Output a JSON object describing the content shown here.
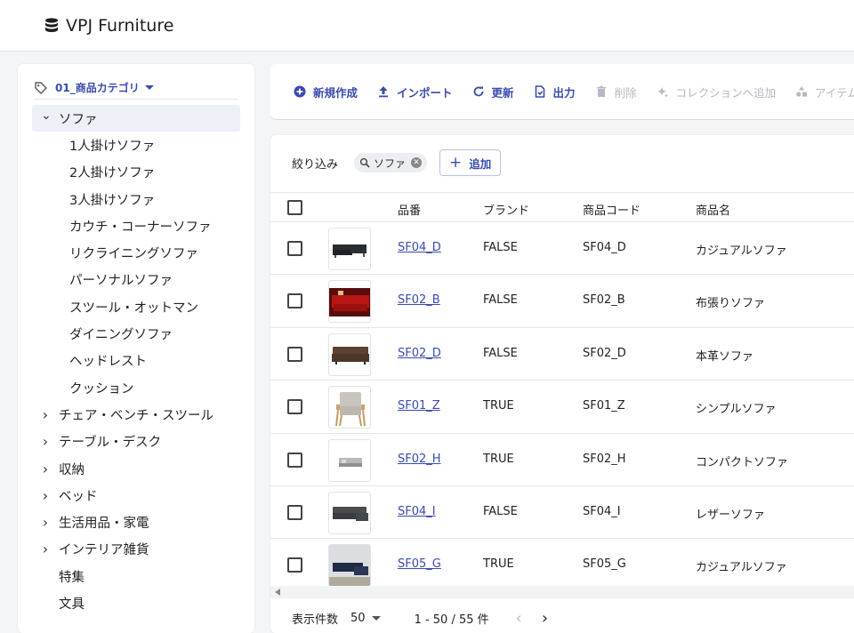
{
  "app": {
    "title": "VPJ Furniture",
    "logo_icon": "database-icon"
  },
  "sidebar": {
    "category_select": "01_商品カテゴリ",
    "tree": [
      {
        "label": "ソファ",
        "expanded": true,
        "selected": true,
        "level": 0
      },
      {
        "label": "1人掛けソファ",
        "level": 1
      },
      {
        "label": "2人掛けソファ",
        "level": 1
      },
      {
        "label": "3人掛けソファ",
        "level": 1
      },
      {
        "label": "カウチ・コーナーソファ",
        "level": 1
      },
      {
        "label": "リクライニングソファ",
        "level": 1
      },
      {
        "label": "パーソナルソファ",
        "level": 1
      },
      {
        "label": "スツール・オットマン",
        "level": 1
      },
      {
        "label": "ダイニングソファ",
        "level": 1
      },
      {
        "label": "ヘッドレスト",
        "level": 1
      },
      {
        "label": "クッション",
        "level": 1
      },
      {
        "label": "チェア・ベンチ・スツール",
        "level": 0,
        "expandable": true
      },
      {
        "label": "テーブル・デスク",
        "level": 0,
        "expandable": true
      },
      {
        "label": "収納",
        "level": 0,
        "expandable": true
      },
      {
        "label": "ベッド",
        "level": 0,
        "expandable": true
      },
      {
        "label": "生活用品・家電",
        "level": 0,
        "expandable": true
      },
      {
        "label": "インテリア雑貨",
        "level": 0,
        "expandable": true
      },
      {
        "label": "特集",
        "level": 0
      },
      {
        "label": "文具",
        "level": 0
      }
    ]
  },
  "toolbar": {
    "new": "新規作成",
    "import": "インポート",
    "refresh": "更新",
    "export": "出力",
    "delete": "削除",
    "add_to_collection": "コレクションへ追加",
    "item_group": "アイテムグ"
  },
  "filter": {
    "label": "絞り込み",
    "chip": "ソファ",
    "add_button": "追加"
  },
  "table": {
    "headers": [
      "品番",
      "ブランド",
      "商品コード",
      "商品名"
    ],
    "rows": [
      {
        "part_no": "SF04_D",
        "brand": "FALSE",
        "code": "SF04_D",
        "name": "カジュアルソファ"
      },
      {
        "part_no": "SF02_B",
        "brand": "FALSE",
        "code": "SF02_B",
        "name": "布張りソファ"
      },
      {
        "part_no": "SF02_D",
        "brand": "FALSE",
        "code": "SF02_D",
        "name": "本革ソファ"
      },
      {
        "part_no": "SF01_Z",
        "brand": "TRUE",
        "code": "SF01_Z",
        "name": "シンプルソファ"
      },
      {
        "part_no": "SF02_H",
        "brand": "TRUE",
        "code": "SF02_H",
        "name": "コンパクトソファ"
      },
      {
        "part_no": "SF04_I",
        "brand": "FALSE",
        "code": "SF04_I",
        "name": "レザーソファ"
      },
      {
        "part_no": "SF05_G",
        "brand": "TRUE",
        "code": "SF05_G",
        "name": "カジュアルソファ"
      }
    ]
  },
  "pager": {
    "rows_label": "表示件数",
    "rows_per_page": "50",
    "range": "1 - 50 / 55 件"
  },
  "colors": {
    "accent": "#3a4bb0",
    "disabled": "#b5b8c2",
    "background": "#f4f5f7"
  }
}
